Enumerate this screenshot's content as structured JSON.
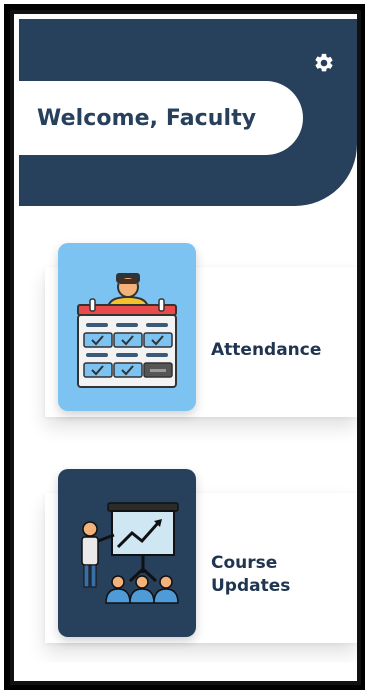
{
  "header": {
    "welcome": "Welcome, Faculty",
    "settings_icon": "gear-icon"
  },
  "cards": [
    {
      "label": "Attendance",
      "icon": "attendance-calendar-icon"
    },
    {
      "label_line1": "Course",
      "label_line2": "Updates",
      "icon": "presentation-board-icon"
    }
  ],
  "colors": {
    "primary": "#27405c",
    "attendance_tile": "#7cc3f2",
    "course_tile": "#27405c"
  }
}
